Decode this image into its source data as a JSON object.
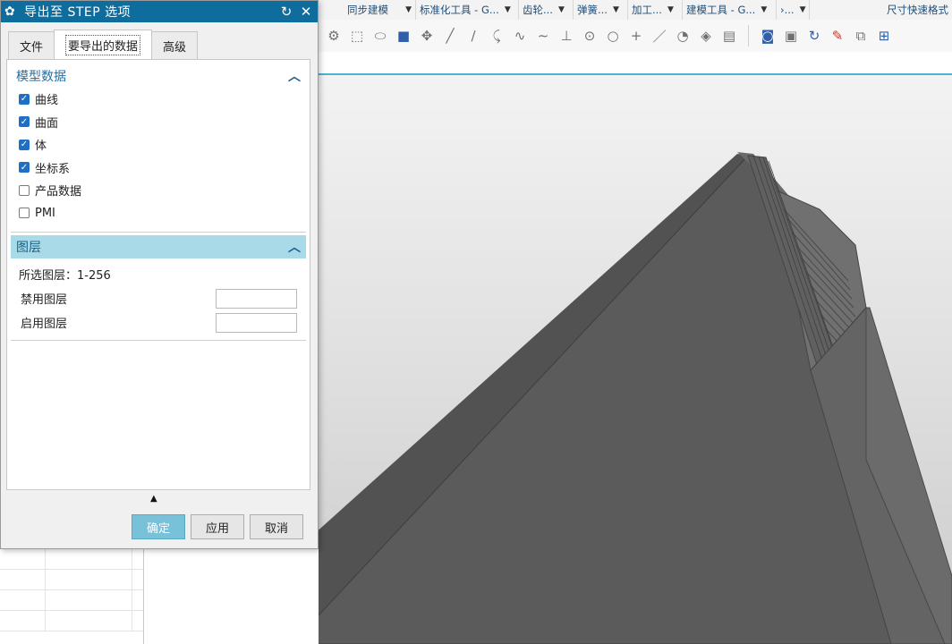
{
  "dialog": {
    "title": "导出至 STEP 选项",
    "tabs": [
      {
        "label": "文件"
      },
      {
        "label": "要导出的数据"
      },
      {
        "label": "高级"
      }
    ],
    "model_data": {
      "header": "模型数据",
      "items": [
        {
          "label": "曲线",
          "checked": true
        },
        {
          "label": "曲面",
          "checked": true
        },
        {
          "label": "体",
          "checked": true
        },
        {
          "label": "坐标系",
          "checked": true
        },
        {
          "label": "产品数据",
          "checked": false
        },
        {
          "label": "PMI",
          "checked": false
        }
      ]
    },
    "layers": {
      "header": "图层",
      "selected_layers": "所选图层：1-256",
      "disabled_label": "禁用图层",
      "disabled_value": "",
      "enabled_label": "启用图层",
      "enabled_value": ""
    },
    "buttons": {
      "ok": "确定",
      "apply": "应用",
      "cancel": "取消"
    }
  },
  "ribbon": {
    "groups": [
      {
        "label": "同步建模"
      },
      {
        "label": "标准化工具 - G..."
      },
      {
        "label": "齿轮..."
      },
      {
        "label": "弹簧..."
      },
      {
        "label": "加工..."
      },
      {
        "label": "建模工具 - G..."
      },
      {
        "label": "›..."
      }
    ],
    "right_label": "尺寸快速格式"
  },
  "colors": {
    "titlebar": "#0f6d9e",
    "accent": "#79c1d9",
    "checkbox": "#1f6fc6",
    "section_highlight": "#a8dbe7"
  }
}
